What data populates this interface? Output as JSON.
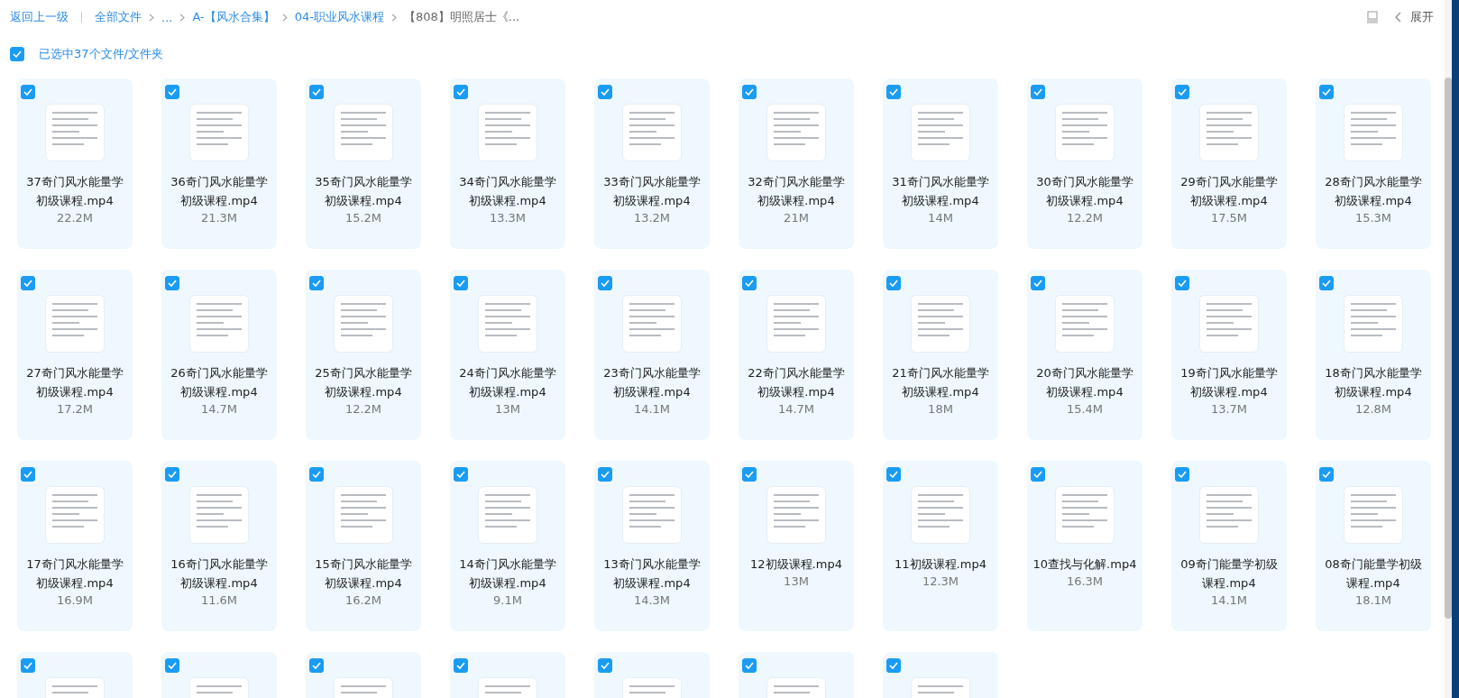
{
  "breadcrumb": {
    "back": "返回上一级",
    "items": [
      {
        "label": "全部文件",
        "current": false
      },
      {
        "label": "...",
        "current": false
      },
      {
        "label": "A-【风水合集】",
        "current": false
      },
      {
        "label": "04-职业风水课程",
        "current": false
      },
      {
        "label": "【808】明照居士《...",
        "current": true
      }
    ]
  },
  "toolbar": {
    "expand": "展开"
  },
  "select_all": {
    "checked": true,
    "label": "已选中37个文件/文件夹"
  },
  "files": [
    {
      "name": "37奇门风水能量学初级课程.mp4",
      "size": "22.2M",
      "selected": true
    },
    {
      "name": "36奇门风水能量学初级课程.mp4",
      "size": "21.3M",
      "selected": true
    },
    {
      "name": "35奇门风水能量学初级课程.mp4",
      "size": "15.2M",
      "selected": true
    },
    {
      "name": "34奇门风水能量学初级课程.mp4",
      "size": "13.3M",
      "selected": true
    },
    {
      "name": "33奇门风水能量学初级课程.mp4",
      "size": "13.2M",
      "selected": true
    },
    {
      "name": "32奇门风水能量学初级课程.mp4",
      "size": "21M",
      "selected": true
    },
    {
      "name": "31奇门风水能量学初级课程.mp4",
      "size": "14M",
      "selected": true
    },
    {
      "name": "30奇门风水能量学初级课程.mp4",
      "size": "12.2M",
      "selected": true
    },
    {
      "name": "29奇门风水能量学初级课程.mp4",
      "size": "17.5M",
      "selected": true
    },
    {
      "name": "28奇门风水能量学初级课程.mp4",
      "size": "15.3M",
      "selected": true
    },
    {
      "name": "27奇门风水能量学初级课程.mp4",
      "size": "17.2M",
      "selected": true
    },
    {
      "name": "26奇门风水能量学初级课程.mp4",
      "size": "14.7M",
      "selected": true
    },
    {
      "name": "25奇门风水能量学初级课程.mp4",
      "size": "12.2M",
      "selected": true
    },
    {
      "name": "24奇门风水能量学初级课程.mp4",
      "size": "13M",
      "selected": true
    },
    {
      "name": "23奇门风水能量学初级课程.mp4",
      "size": "14.1M",
      "selected": true
    },
    {
      "name": "22奇门风水能量学初级课程.mp4",
      "size": "14.7M",
      "selected": true
    },
    {
      "name": "21奇门风水能量学初级课程.mp4",
      "size": "18M",
      "selected": true
    },
    {
      "name": "20奇门风水能量学初级课程.mp4",
      "size": "15.4M",
      "selected": true
    },
    {
      "name": "19奇门风水能量学初级课程.mp4",
      "size": "13.7M",
      "selected": true
    },
    {
      "name": "18奇门风水能量学初级课程.mp4",
      "size": "12.8M",
      "selected": true
    },
    {
      "name": "17奇门风水能量学初级课程.mp4",
      "size": "16.9M",
      "selected": true
    },
    {
      "name": "16奇门风水能量学初级课程.mp4",
      "size": "11.6M",
      "selected": true
    },
    {
      "name": "15奇门风水能量学初级课程.mp4",
      "size": "16.2M",
      "selected": true
    },
    {
      "name": "14奇门风水能量学初级课程.mp4",
      "size": "9.1M",
      "selected": true
    },
    {
      "name": "13奇门风水能量学初级课程.mp4",
      "size": "14.3M",
      "selected": true
    },
    {
      "name": "12初级课程.mp4",
      "size": "13M",
      "selected": true
    },
    {
      "name": "11初级课程.mp4",
      "size": "12.3M",
      "selected": true
    },
    {
      "name": "10查找与化解.mp4",
      "size": "16.3M",
      "selected": true
    },
    {
      "name": "09奇门能量学初级课程.mp4",
      "size": "14.1M",
      "selected": true
    },
    {
      "name": "08奇门能量学初级课程.mp4",
      "size": "18.1M",
      "selected": true
    },
    {
      "selected": true
    },
    {
      "selected": true
    },
    {
      "selected": true
    },
    {
      "selected": true
    },
    {
      "selected": true
    },
    {
      "selected": true
    },
    {
      "selected": true
    }
  ]
}
